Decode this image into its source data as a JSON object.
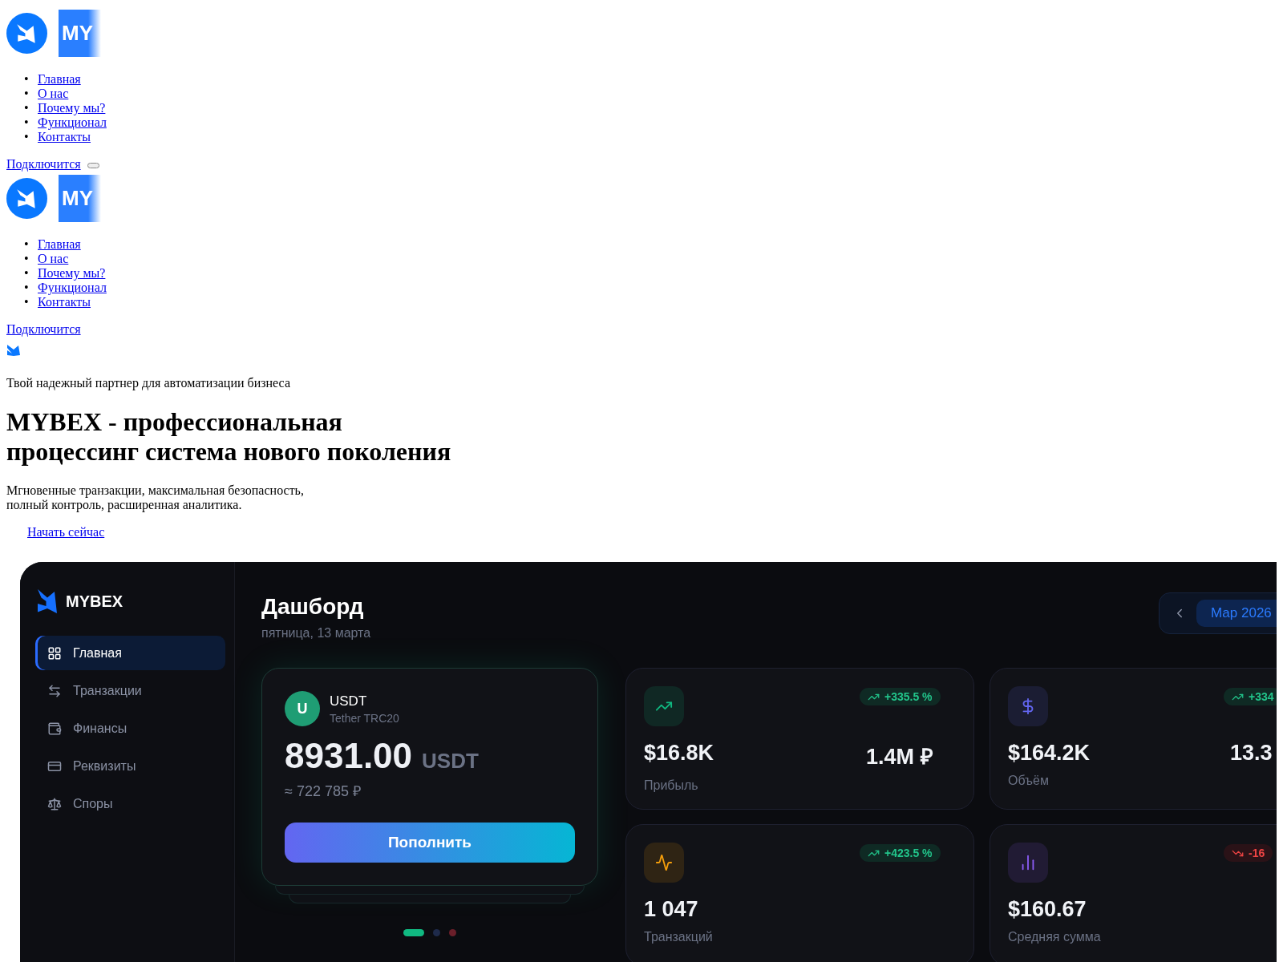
{
  "headers": [
    {
      "kind": "desktop",
      "logo_text": "MY",
      "menu_open": false,
      "bullet": "•",
      "nav": [
        "Главная",
        "О нас",
        "Почему мы?",
        "Функционал",
        "Контакты"
      ],
      "cta": "Подключится"
    },
    {
      "kind": "mobile",
      "logo_text": "MY",
      "bullet": "•",
      "nav": [
        "Главная",
        "О нас",
        "Почему мы?",
        "Функционал",
        "Контакты"
      ],
      "cta": "Подключится"
    }
  ],
  "hero": {
    "tagline": "Твой надежный партнер для автоматизации бизнеса",
    "title_lines": [
      "MYBEX - профессиональная",
      "процессинг система нового поколения"
    ],
    "subtitle_lines": [
      "Мгновенные транзакции, максимальная безопасность,",
      "полный контроль, расширенная аналитика."
    ],
    "cta": "Начать сейчас"
  },
  "dashboard": {
    "brand": "MYBEX",
    "nav": [
      {
        "kind": "grid",
        "label": "Главная",
        "selected": true
      },
      {
        "kind": "transfer",
        "label": "Транзакции",
        "selected": false
      },
      {
        "kind": "wallet",
        "label": "Финансы",
        "selected": false
      },
      {
        "kind": "card",
        "label": "Реквизиты",
        "selected": false
      },
      {
        "kind": "scales",
        "label": "Споры",
        "selected": false
      }
    ],
    "title": "Дашборд",
    "date": "пятница, 13 марта",
    "period": "Мар 2026",
    "wallet": {
      "avatar": "U",
      "symbol": "USDT",
      "network": "Tether TRC20",
      "amount": "8931.00",
      "unit": "USDT",
      "approx": "≈ 722 785 ₽",
      "button": "Пополнить"
    },
    "dots": [
      {
        "selected": true,
        "color": "#10b981"
      },
      {
        "selected": false,
        "color": "#1e2a4a"
      },
      {
        "selected": false,
        "color": "#6b1f2a"
      }
    ],
    "stats": [
      {
        "kind": "trend",
        "color": "#10b981",
        "change": "+335.5 %",
        "rising": true,
        "value": "$16.8K",
        "secondary": "1.4M ₽",
        "label": "Прибыль"
      },
      {
        "kind": "dollar",
        "color": "#6366f1",
        "change": "+334",
        "rising": true,
        "value": "$164.2K",
        "secondary": "13.3",
        "label": "Объём"
      },
      {
        "kind": "pulse",
        "color": "#f59e0b",
        "change": "+423.5 %",
        "rising": true,
        "value": "1 047",
        "label": "Транзакций"
      },
      {
        "kind": "bars",
        "color": "#8b5cf6",
        "change": "-16",
        "rising": false,
        "value": "$160.67",
        "label": "Средняя сумма"
      }
    ]
  }
}
